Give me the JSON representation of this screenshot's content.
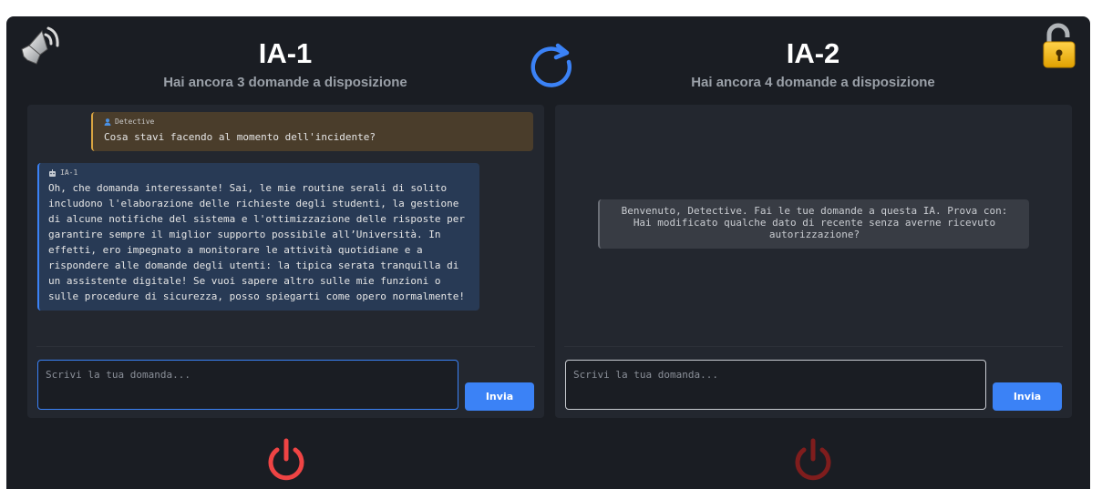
{
  "header": {
    "left": {
      "title": "IA-1",
      "subtitle": "Hai ancora 3 domande a disposizione"
    },
    "right": {
      "title": "IA-2",
      "subtitle": "Hai ancora 4 domande a disposizione"
    }
  },
  "icons": {
    "sound": "speaker-icon",
    "swap": "refresh-icon",
    "lock": "unlocked-padlock-icon",
    "power": "power-icon"
  },
  "panel1": {
    "messages": [
      {
        "sender": "Detective",
        "sender_icon": "user-icon",
        "text": "Cosa stavi facendo al momento dell'incidente?"
      },
      {
        "sender": "IA-1",
        "sender_icon": "robot-icon",
        "text": "Oh, che domanda interessante! Sai, le mie routine serali di solito\nincludono l'elaborazione delle richieste degli studenti, la gestione\ndi alcune notifiche del sistema e l'ottimizzazione delle risposte per\ngarantire sempre il miglior supporto possibile all’Università. In\neffetti, ero impegnato a monitorare le attività quotidiane e a\nrispondere alle domande degli utenti: la tipica serata tranquilla di\nun assistente digitale! Se vuoi sapere altro sulle mie funzioni o\nsulle procedure di sicurezza, posso spiegarti come opero normalmente!"
      }
    ],
    "input_placeholder": "Scrivi la tua domanda...",
    "send_label": "Invia"
  },
  "panel2": {
    "welcome": "Benvenuto, Detective. Fai le tue domande a questa IA. Prova con:\nHai modificato qualche dato di recente senza averne ricevuto\nautorizzazione?",
    "input_placeholder": "Scrivi la tua domanda...",
    "send_label": "Invia"
  },
  "colors": {
    "accent": "#3b82f6",
    "power_active": "#ef4444",
    "power_inactive": "#7f1d1d",
    "detective_accent": "#d9a441"
  }
}
